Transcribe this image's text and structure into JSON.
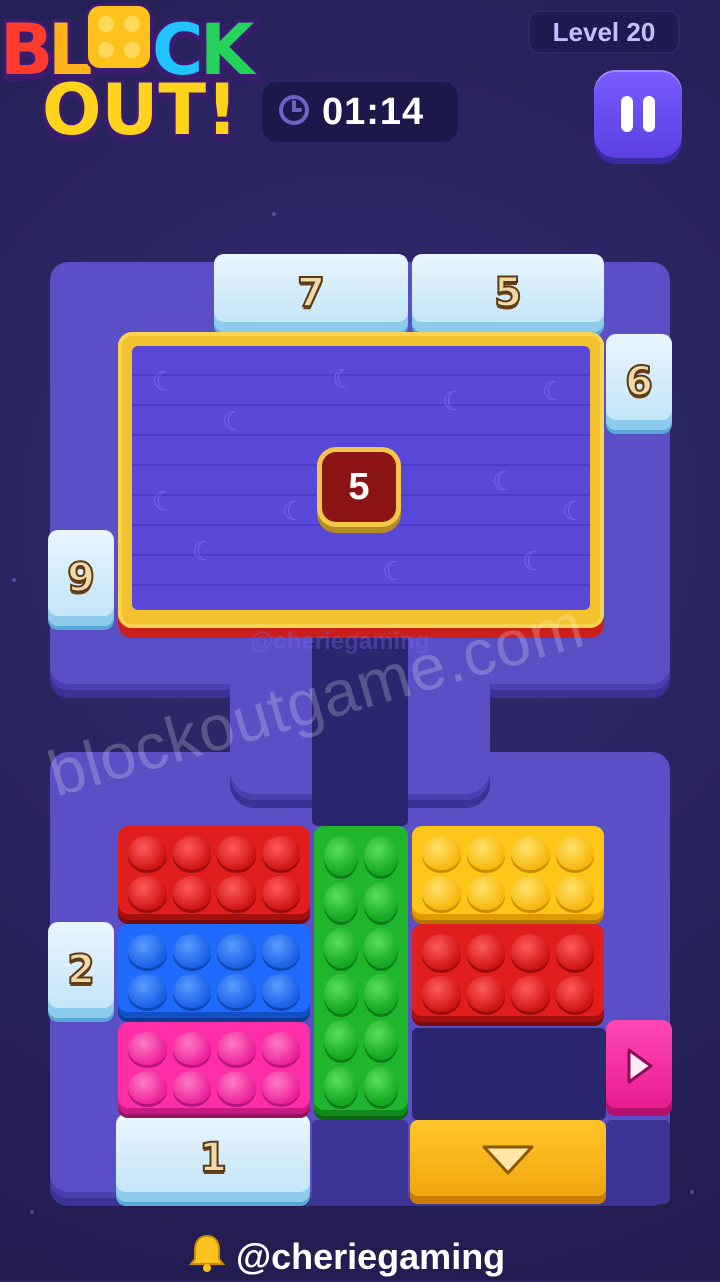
{
  "header": {
    "logo_text": "BLOCK OUT!",
    "level_label": "Level 20",
    "timer": "01:14"
  },
  "board": {
    "gates": {
      "top_left": "7",
      "top_right": "5",
      "right_upper": "6",
      "left_middle": "9",
      "left_lower": "2",
      "bottom": "1"
    },
    "container_count": "5",
    "blocks": [
      {
        "color": "red",
        "studs": "4x2"
      },
      {
        "color": "blue",
        "studs": "4x2"
      },
      {
        "color": "pink",
        "studs": "4x2"
      },
      {
        "color": "green",
        "studs": "2x6"
      },
      {
        "color": "yellow",
        "studs": "4x2"
      },
      {
        "color": "red",
        "studs": "4x2"
      }
    ],
    "colors": {
      "red": "#e11d1d",
      "blue": "#1f6bff",
      "pink": "#ff2ea6",
      "green": "#1fb52c",
      "yellow": "#ffc61a"
    }
  },
  "watermarks": {
    "diagonal": "blockoutgame.com",
    "faint": "@cheriegaming"
  },
  "footer": {
    "handle": "@cheriegaming",
    "icon": "bell-icon"
  }
}
